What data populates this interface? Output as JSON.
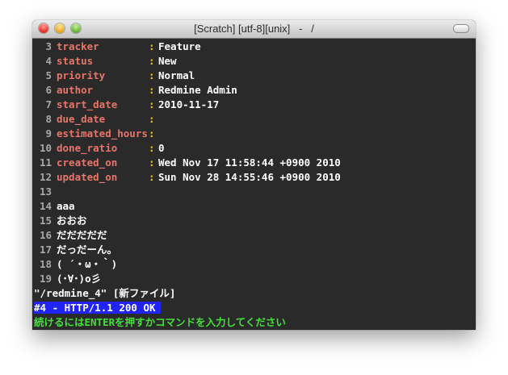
{
  "window": {
    "title": "[Scratch] [utf-8][unix]   -   /"
  },
  "fields": [
    {
      "num": "3",
      "key": "tracker",
      "sep": ":",
      "value": "Feature"
    },
    {
      "num": "4",
      "key": "status",
      "sep": ":",
      "value": "New"
    },
    {
      "num": "5",
      "key": "priority",
      "sep": ":",
      "value": "Normal"
    },
    {
      "num": "6",
      "key": "author",
      "sep": ":",
      "value": "Redmine Admin"
    },
    {
      "num": "7",
      "key": "start_date",
      "sep": ":",
      "value": "2010-11-17"
    },
    {
      "num": "8",
      "key": "due_date",
      "sep": ":",
      "value": ""
    },
    {
      "num": "9",
      "key": "estimated_hours",
      "sep": ":",
      "value": ""
    },
    {
      "num": "10",
      "key": "done_ratio",
      "sep": ":",
      "value": "0"
    },
    {
      "num": "11",
      "key": "created_on",
      "sep": ":",
      "value": "Wed Nov 17 11:58:44 +0900 2010"
    },
    {
      "num": "12",
      "key": "updated_on",
      "sep": ":",
      "value": "Sun Nov 28 14:55:46 +0900 2010"
    }
  ],
  "body_lines": [
    {
      "num": "13",
      "text": ""
    },
    {
      "num": "14",
      "text": "aaa"
    },
    {
      "num": "15",
      "text": "おおお"
    },
    {
      "num": "16",
      "text": "だだだだだ"
    },
    {
      "num": "17",
      "text": "だっだーん。"
    },
    {
      "num": "18",
      "text": "( ´・ω・｀)"
    },
    {
      "num": "19",
      "text": "(･∀･)o彡"
    }
  ],
  "statusline": "\"/redmine_4\" [新ファイル]",
  "messages": {
    "http": "#4 - HTTP/1.1 200 OK",
    "prompt": "続けるにはENTERを押すかコマンドを入力してください"
  },
  "colors": {
    "key": "#e9756a",
    "separator": "#f0c800",
    "highlight_bg": "#1f24f2",
    "prompt": "#45e03a",
    "background": "#2a2a2a"
  }
}
